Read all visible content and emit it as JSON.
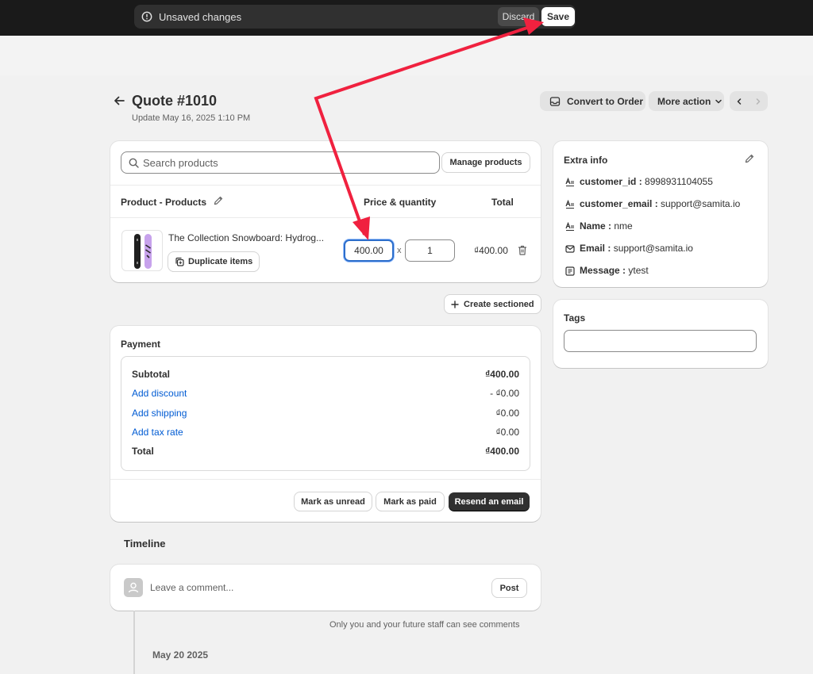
{
  "save_bar": {
    "message": "Unsaved changes",
    "discard_label": "Discard",
    "save_label": "Save"
  },
  "header": {
    "title": "Quote #1010",
    "subtitle": "Update May 16, 2025 1:10 PM",
    "convert_label": "Convert to Order",
    "more_label": "More action"
  },
  "products": {
    "search_placeholder": "Search products",
    "manage_label": "Manage products",
    "columns": {
      "product": "Product - Products",
      "price_qty": "Price & quantity",
      "total": "Total"
    },
    "items": [
      {
        "name": "The Collection Snowboard: Hydrog...",
        "duplicate_label": "Duplicate items",
        "price": "400.00",
        "times": "x",
        "quantity": "1",
        "total": "₫400.00"
      }
    ],
    "create_section_label": "Create sectioned"
  },
  "payment": {
    "title": "Payment",
    "rows": [
      {
        "label": "Subtotal",
        "value": "₫400.00"
      },
      {
        "label": "Add discount",
        "value": "- ₫0.00"
      },
      {
        "label": "Add shipping",
        "value": "₫0.00"
      },
      {
        "label": "Add tax rate",
        "value": "₫0.00"
      },
      {
        "label": "Total",
        "value": "₫400.00"
      }
    ],
    "buttons": {
      "unread": "Mark as unread",
      "paid": "Mark as paid",
      "resend": "Resend an email"
    }
  },
  "timeline": {
    "title": "Timeline",
    "comment_placeholder": "Leave a comment...",
    "post_label": "Post",
    "staff_note": "Only you and your future staff can see comments",
    "date": "May 20 2025"
  },
  "extra_info": {
    "title": "Extra info",
    "rows": [
      {
        "key": "customer_id :",
        "value": " 8998931104055",
        "icon": "text-field-icon"
      },
      {
        "key": "customer_email :",
        "value": " support@samita.io",
        "icon": "text-field-icon"
      },
      {
        "key": "Name :",
        "value": " nme",
        "icon": "text-field-icon"
      },
      {
        "key": "Email :",
        "value": " support@samita.io",
        "icon": "envelope-icon"
      },
      {
        "key": "Message :",
        "value": " ytest",
        "icon": "note-icon"
      }
    ]
  },
  "tags": {
    "title": "Tags",
    "value": ""
  },
  "colors": {
    "accent": "#005bd3",
    "annotation": "#f0213f",
    "focus": "#2c6ecb",
    "dark": "#303030"
  }
}
